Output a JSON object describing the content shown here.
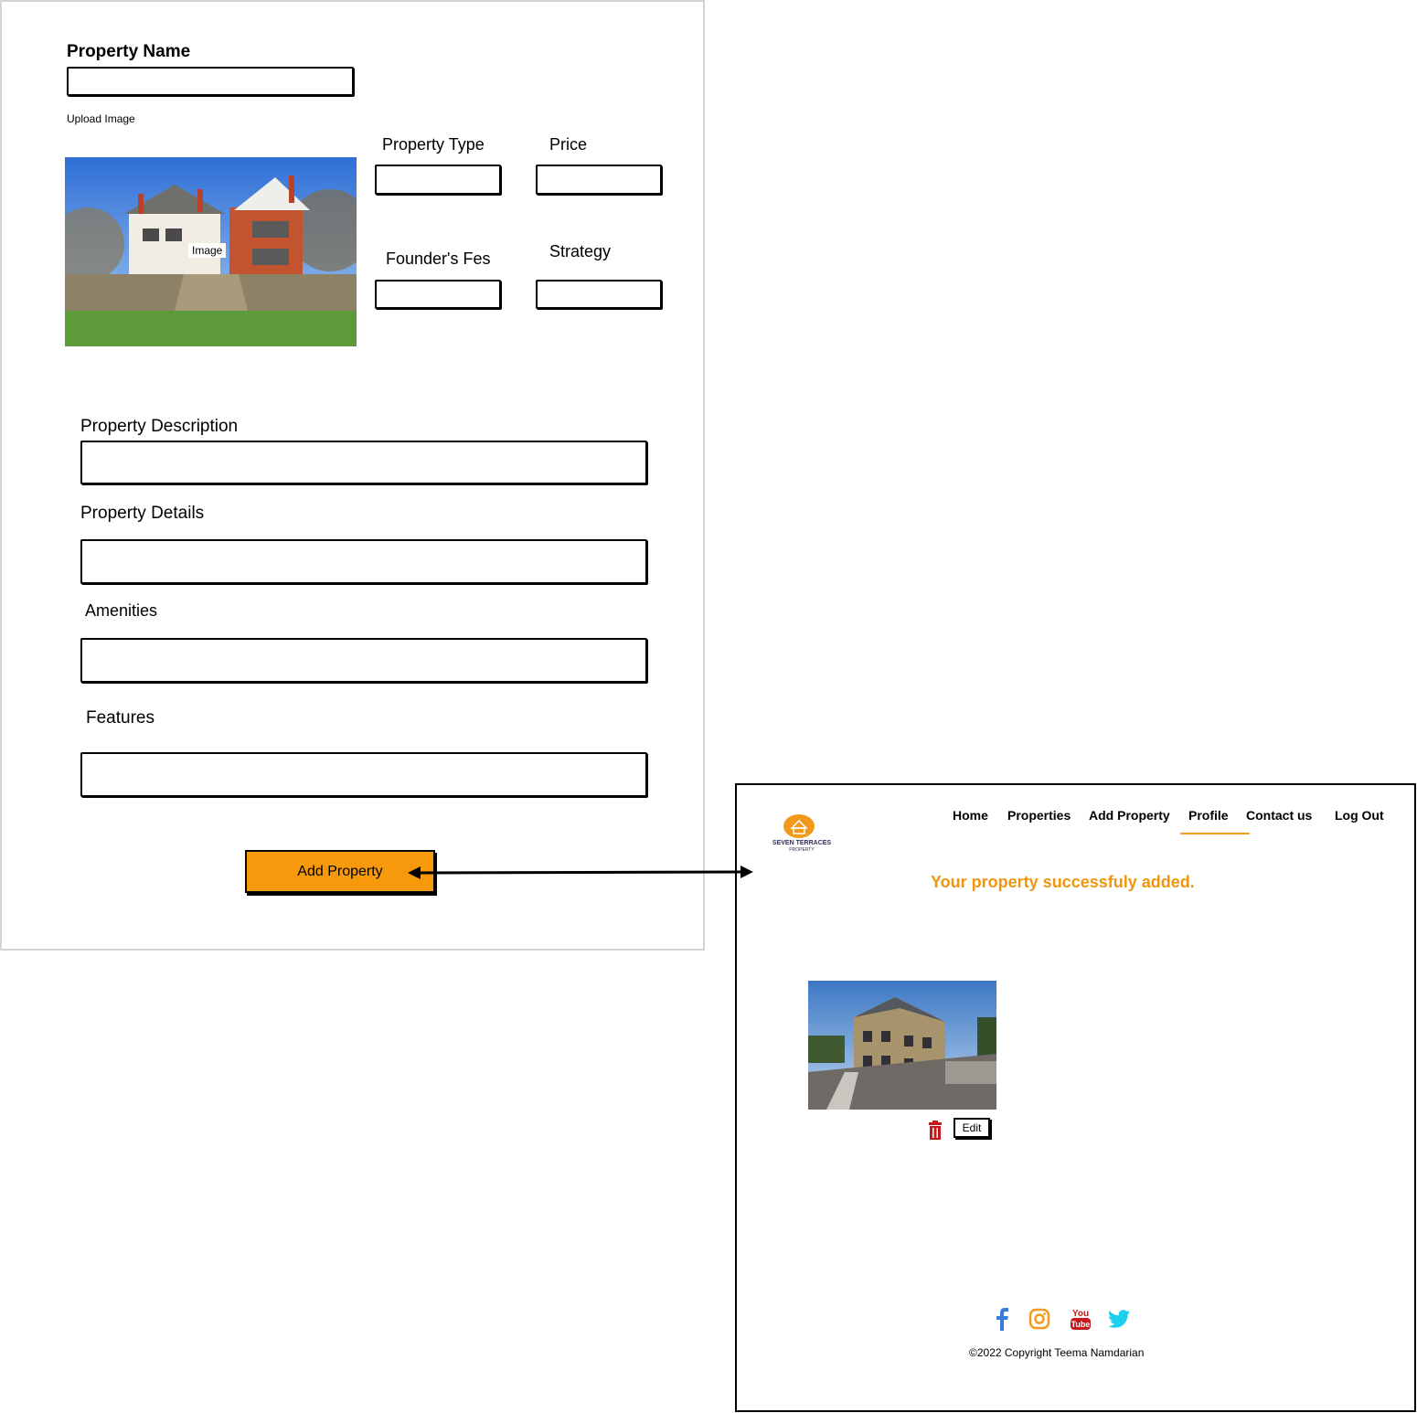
{
  "form": {
    "property_name_label": "Property Name",
    "upload_image_label": "Upload Image",
    "image_placeholder_label": "Image",
    "property_type_label": "Property Type",
    "price_label": "Price",
    "founders_fee_label": "Founder's Fes",
    "strategy_label": "Strategy",
    "description_label": "Property Description",
    "details_label": "Property Details",
    "amenities_label": "Amenities",
    "features_label": "Features",
    "submit_label": "Add Property"
  },
  "profile": {
    "logo_text_line1": "SEVEN TERRACES",
    "logo_text_line2": "PROPERTY",
    "nav": {
      "home": "Home",
      "properties": "Properties",
      "add_property": "Add Property",
      "profile": "Profile",
      "contact": "Contact us",
      "logout": "Log Out"
    },
    "active_nav": "Profile",
    "success_message": "Your property successfuly added.",
    "edit_label": "Edit",
    "delete_icon": "trash-icon",
    "social_icons": [
      "facebook-icon",
      "instagram-icon",
      "youtube-icon",
      "twitter-icon"
    ],
    "copyright": "©2022 Copyright Teema Namdarian"
  },
  "colors": {
    "accent": "#f7990c",
    "success_text": "#f0960e",
    "delete_red": "#c8171b",
    "facebook": "#3b7bd9",
    "instagram": "#f29a1b",
    "youtube": "#c8171b",
    "twitter": "#1ed0f0"
  }
}
